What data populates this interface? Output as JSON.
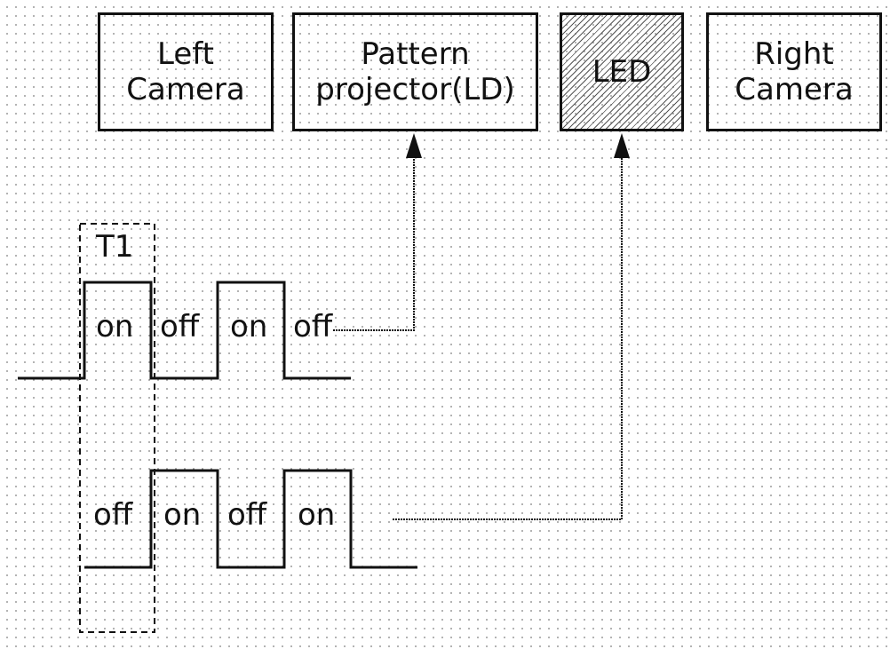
{
  "blocks": [
    {
      "id": "left-camera",
      "lines": [
        "Left",
        "Camera"
      ],
      "hatched": false
    },
    {
      "id": "pattern-projector",
      "lines": [
        "Pattern",
        "projector(LD)"
      ],
      "hatched": false
    },
    {
      "id": "led",
      "lines": [
        "LED"
      ],
      "hatched": true
    },
    {
      "id": "right-camera",
      "lines": [
        "Right",
        "Camera"
      ],
      "hatched": false
    }
  ],
  "period_label": "T1",
  "waveforms": {
    "projector": {
      "states": [
        "on",
        "off",
        "on",
        "off"
      ],
      "target": "Pattern projector(LD)"
    },
    "led": {
      "states": [
        "off",
        "on",
        "off",
        "on"
      ],
      "target": "LED"
    }
  }
}
